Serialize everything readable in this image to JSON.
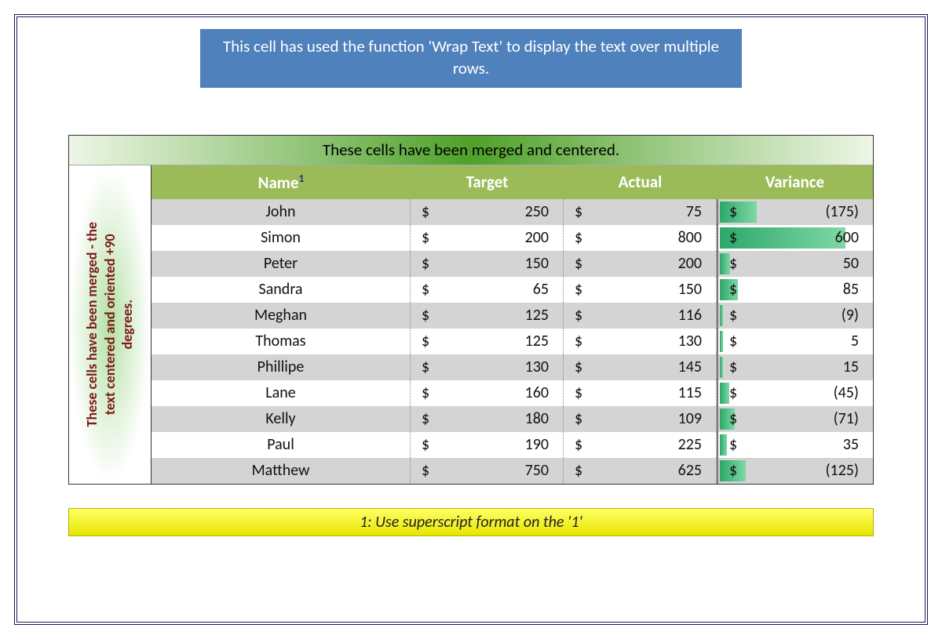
{
  "banner": "This cell has used the function 'Wrap Text' to display the text over multiple rows.",
  "merged_top": "These cells have been merged and centered.",
  "vertical_line1": "These cells have been merged - the",
  "vertical_line2": "text centered and oriented +90",
  "vertical_line3": "degrees.",
  "headers": {
    "name": "Name",
    "sup": "1",
    "target": "Target",
    "actual": "Actual",
    "variance": "Variance"
  },
  "currency": "$",
  "footnote": "1: Use superscript format on the '1'",
  "chart_data": {
    "type": "table",
    "title": "Name / Target / Actual / Variance",
    "columns": [
      "Name",
      "Target",
      "Actual",
      "Variance"
    ],
    "rows": [
      {
        "name": "John",
        "target": 250,
        "actual": 75,
        "variance": -175
      },
      {
        "name": "Simon",
        "target": 200,
        "actual": 800,
        "variance": 600
      },
      {
        "name": "Peter",
        "target": 150,
        "actual": 200,
        "variance": 50
      },
      {
        "name": "Sandra",
        "target": 65,
        "actual": 150,
        "variance": 85
      },
      {
        "name": "Meghan",
        "target": 125,
        "actual": 116,
        "variance": -9
      },
      {
        "name": "Thomas",
        "target": 125,
        "actual": 130,
        "variance": 5
      },
      {
        "name": "Phillipe",
        "target": 130,
        "actual": 145,
        "variance": 15
      },
      {
        "name": "Lane",
        "target": 160,
        "actual": 115,
        "variance": -45
      },
      {
        "name": "Kelly",
        "target": 180,
        "actual": 109,
        "variance": -71
      },
      {
        "name": "Paul",
        "target": 190,
        "actual": 225,
        "variance": 35
      },
      {
        "name": "Matthew",
        "target": 750,
        "actual": 625,
        "variance": -125
      }
    ],
    "variance_bar_max": 600
  }
}
